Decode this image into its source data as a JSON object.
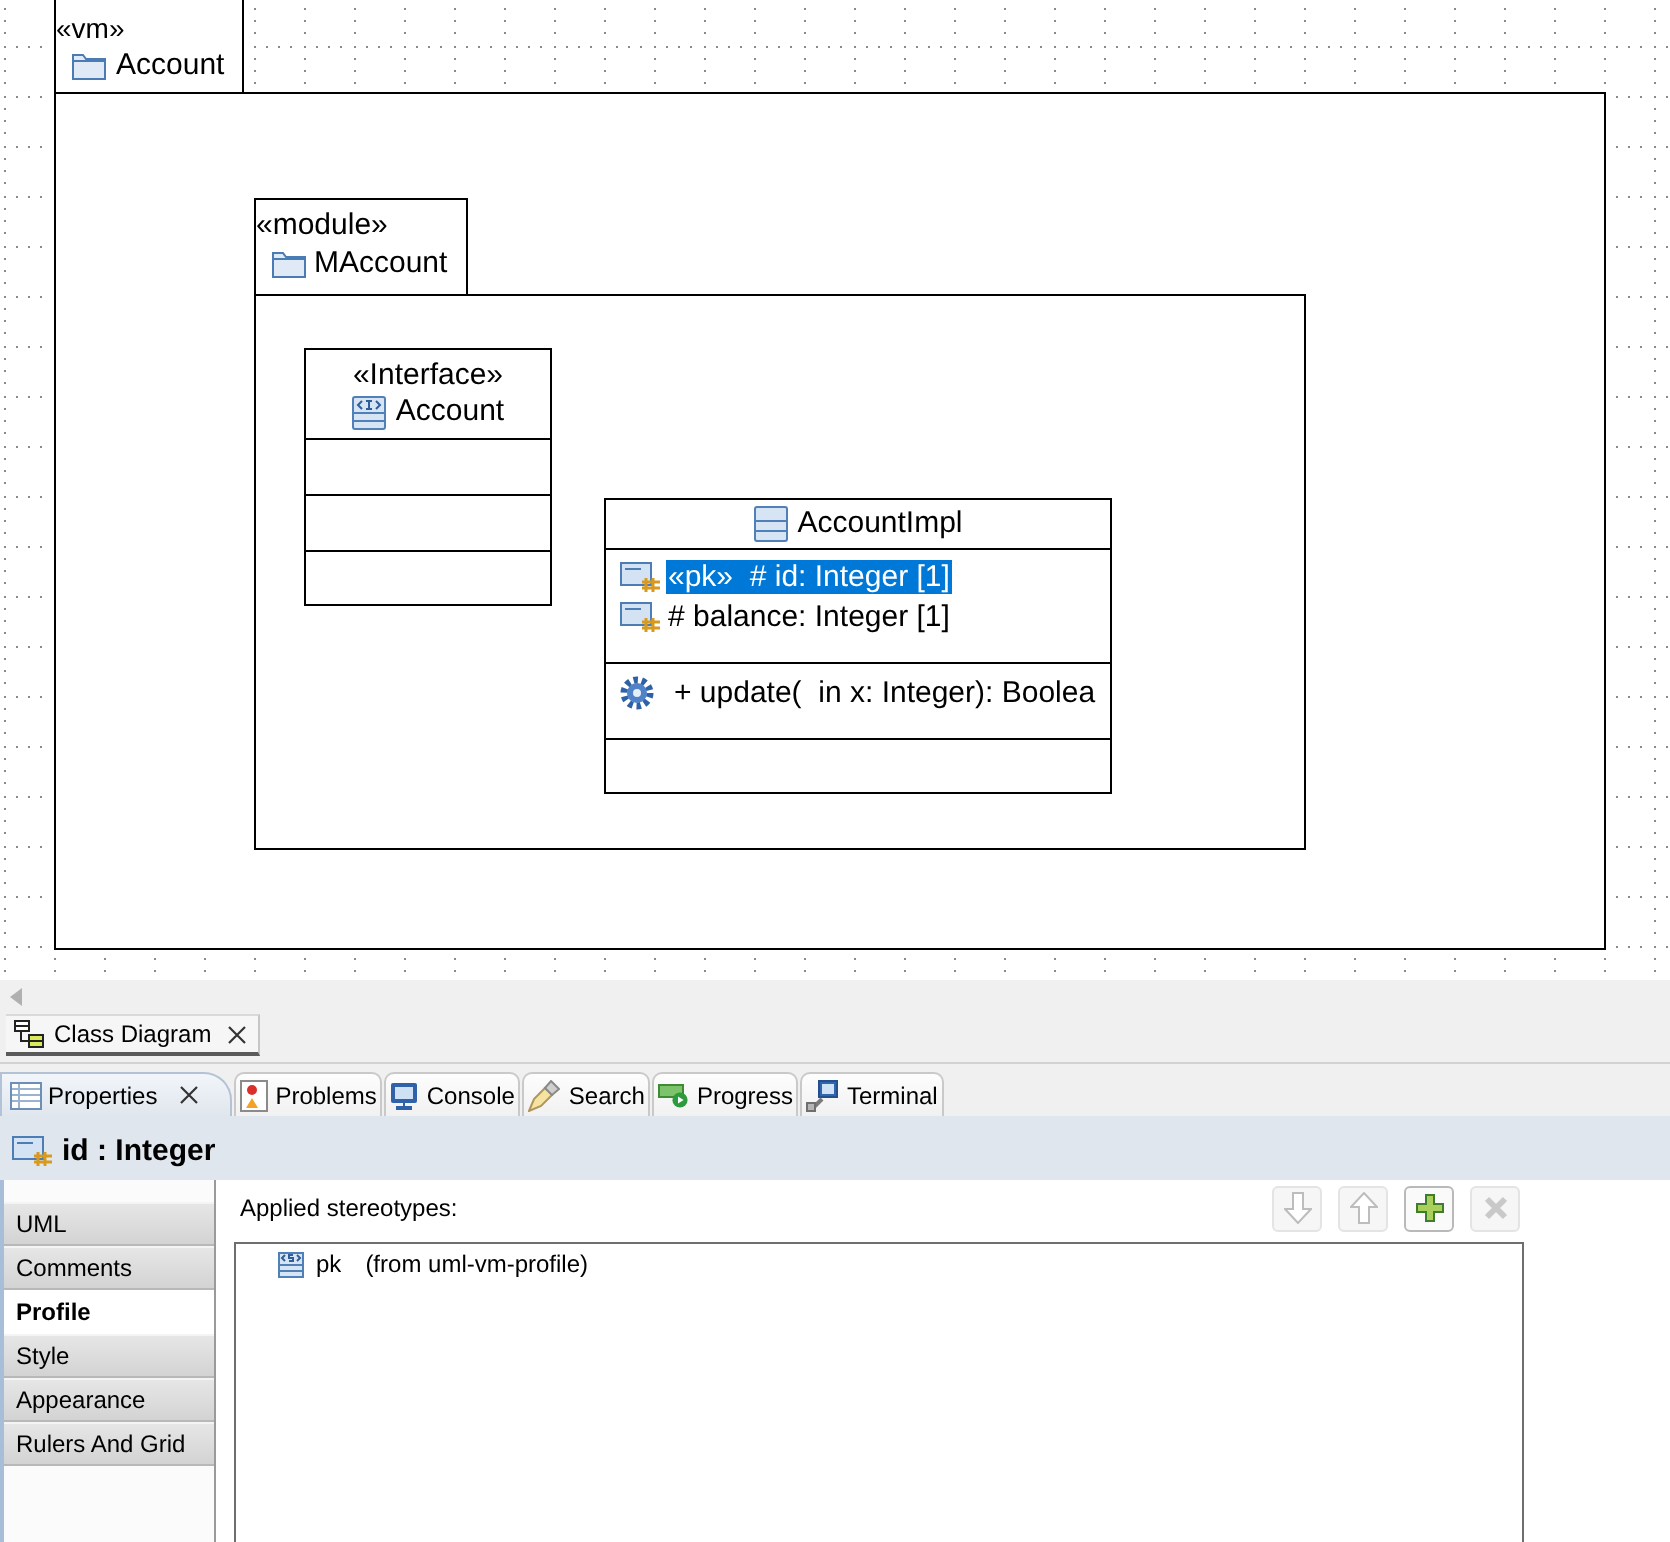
{
  "diagram": {
    "package": {
      "stereotype": "«vm»",
      "name": "Account",
      "package": {
        "stereotype": "«module»",
        "name": "MAccount",
        "classifiers": [
          {
            "kind": "interface",
            "stereotype": "«Interface»",
            "name": "Account"
          },
          {
            "kind": "class",
            "name": "AccountImpl",
            "attributes": [
              {
                "text": "«pk»  # id: Integer [1]",
                "selected": true
              },
              {
                "text": "# balance: Integer [1]",
                "selected": false
              }
            ],
            "operations": [
              {
                "text": "+ update(  in x: Integer): Boolea"
              }
            ]
          }
        ]
      }
    }
  },
  "editor_tabs": [
    {
      "label": "Class Diagram",
      "selected": true
    }
  ],
  "view_tabs": [
    {
      "label": "Properties",
      "selected": true
    },
    {
      "label": "Problems",
      "selected": false
    },
    {
      "label": "Console",
      "selected": false
    },
    {
      "label": "Search",
      "selected": false
    },
    {
      "label": "Progress",
      "selected": false
    },
    {
      "label": "Terminal",
      "selected": false
    }
  ],
  "properties": {
    "title": "id : Integer",
    "sections": [
      {
        "label": "UML",
        "selected": false
      },
      {
        "label": "Comments",
        "selected": false
      },
      {
        "label": "Profile",
        "selected": true
      },
      {
        "label": "Style",
        "selected": false
      },
      {
        "label": "Appearance",
        "selected": false
      },
      {
        "label": "Rulers And Grid",
        "selected": false
      }
    ],
    "applied_stereotypes": {
      "label": "Applied stereotypes:",
      "buttons": [
        {
          "kind": "down",
          "disabled": true
        },
        {
          "kind": "up",
          "disabled": true
        },
        {
          "kind": "add",
          "disabled": false
        },
        {
          "kind": "remove",
          "disabled": true
        }
      ],
      "items": [
        {
          "name": "pk",
          "source": "(from uml-vm-profile)"
        }
      ]
    }
  }
}
